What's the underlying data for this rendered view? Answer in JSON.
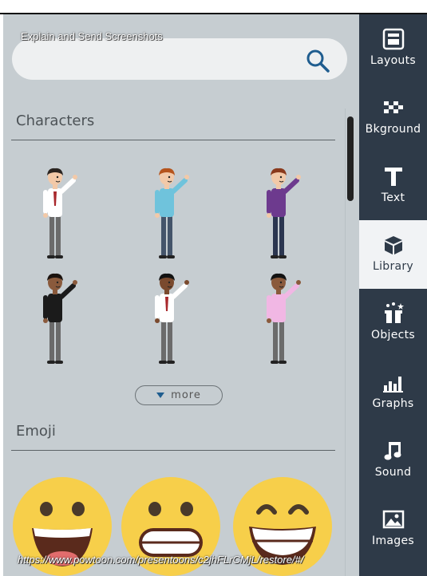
{
  "caption": "Explain and Send Screenshots",
  "search": {
    "placeholder": "",
    "value": ""
  },
  "sections": {
    "characters": {
      "title": "Characters",
      "more_label": "more"
    },
    "emoji": {
      "title": "Emoji"
    }
  },
  "sidebar": {
    "items": [
      {
        "label": "Layouts",
        "icon": "layouts-icon"
      },
      {
        "label": "Bkground",
        "icon": "checkerboard-icon"
      },
      {
        "label": "Text",
        "icon": "text-icon"
      },
      {
        "label": "Library",
        "icon": "cube-icon",
        "active": true
      },
      {
        "label": "Objects",
        "icon": "gift-box-icon"
      },
      {
        "label": "Graphs",
        "icon": "bar-chart-icon"
      },
      {
        "label": "Sound",
        "icon": "music-note-icon"
      },
      {
        "label": "Images",
        "icon": "image-icon"
      }
    ]
  },
  "characters": [
    {
      "name": "man-white-shirt-red-tie",
      "shirt": "#ffffff",
      "pants": "#6b6b6b",
      "hair": "#2a2420",
      "skin": "#f2c9a8",
      "tie": "#a8282c"
    },
    {
      "name": "man-blue-shirt-red-hair",
      "shirt": "#6fc3dc",
      "pants": "#44546a",
      "hair": "#b5541c",
      "skin": "#f2c9a8",
      "tie": ""
    },
    {
      "name": "woman-purple-top-glasses",
      "shirt": "#6d3a8e",
      "pants": "#2b3650",
      "hair": "#8a3a1c",
      "skin": "#f2c9a8",
      "tie": ""
    },
    {
      "name": "woman-black-top-curly-hair",
      "shirt": "#1b1b1b",
      "pants": "#6a6a6a",
      "hair": "#1a120e",
      "skin": "#8a5a3c",
      "tie": ""
    },
    {
      "name": "man-white-shirt-dark-skin",
      "shirt": "#ffffff",
      "pants": "#6b6b6b",
      "hair": "#121212",
      "skin": "#7a4a2e",
      "tie": "#a8282c"
    },
    {
      "name": "man-pink-shirt",
      "shirt": "#f1b7e4",
      "pants": "#6b6b6b",
      "hair": "#121212",
      "skin": "#8a5a3c",
      "tie": ""
    }
  ],
  "emoji": [
    {
      "name": "big-grin"
    },
    {
      "name": "grimace"
    },
    {
      "name": "laughing-squint"
    }
  ],
  "url_overlay": "https://www.powtoon.com/presentoons/c2jhFLrCMjL/restore/#/"
}
